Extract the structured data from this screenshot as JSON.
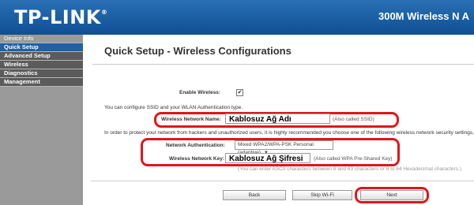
{
  "header": {
    "logo_text": "TP-LINK",
    "logo_mark": "®",
    "product_name": "300M Wireless N A"
  },
  "sidebar": {
    "items": [
      {
        "label": "Device Info"
      },
      {
        "label": "Quick Setup"
      },
      {
        "label": "Advanced Setup"
      },
      {
        "label": "Wireless"
      },
      {
        "label": "Diagnostics"
      },
      {
        "label": "Management"
      }
    ]
  },
  "main": {
    "title": "Quick Setup - Wireless Configurations",
    "enable_wireless_label": "Enable Wireless:",
    "enable_wireless_checked": "✔",
    "ssid_intro": "You can configure SSID and your WLAN Authentication type.",
    "ssid_label": "Wireless Network Name:",
    "ssid_value": "Kablosuz Ağ Adı",
    "ssid_hint": "(Also called SSID)",
    "security_intro": "In order to protect your network from hackers and unauthorized users, it is highly recommended you choose one of the following wireless network security settings.",
    "auth_label": "Network Authentication:",
    "auth_value": "Mixed WPA2/WPA-PSK Personal (adaptive)",
    "key_label": "Wireless Network Key:",
    "key_value": "Kablosuz Ağ Şifresi",
    "key_hint": "(Also called WPA Pre-Shared Key)",
    "key_length_hint": "(You can enter ASCII characters between 8 and 63 characters or 8 to 64 Hexadecimal characters.)"
  },
  "buttons": {
    "back": "Back",
    "skip": "Skip Wi-Fi",
    "next": "Next"
  },
  "colors": {
    "header": "#1a5fa3",
    "sidebar": "#9a9a9a",
    "highlight_ring": "#e0161b"
  }
}
